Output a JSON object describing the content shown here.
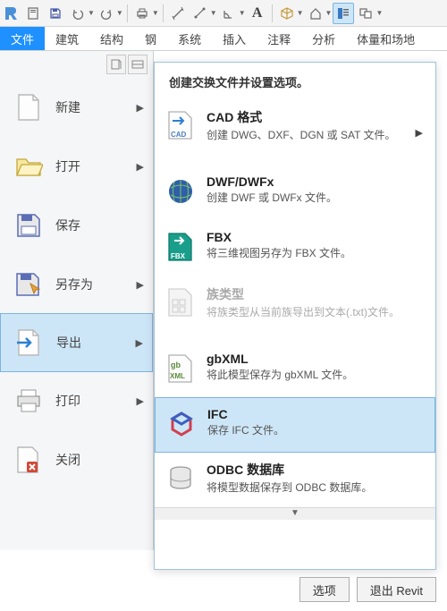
{
  "qat_icons": [
    "logo",
    "page",
    "save",
    "undo",
    "redo",
    "print",
    "measure",
    "dim-angle",
    "dim-radial",
    "text",
    "cube",
    "home",
    "section",
    "props",
    "link"
  ],
  "ribbon_tabs": [
    "文件",
    "建筑",
    "结构",
    "钢",
    "系统",
    "插入",
    "注释",
    "分析",
    "体量和场地"
  ],
  "file_menu": [
    {
      "label": "新建",
      "icon": "new",
      "arrow": true
    },
    {
      "label": "打开",
      "icon": "open",
      "arrow": true
    },
    {
      "label": "保存",
      "icon": "save",
      "arrow": false
    },
    {
      "label": "另存为",
      "icon": "saveas",
      "arrow": true
    },
    {
      "label": "导出",
      "icon": "export",
      "arrow": true,
      "selected": true
    },
    {
      "label": "打印",
      "icon": "print",
      "arrow": true
    },
    {
      "label": "关闭",
      "icon": "close",
      "arrow": false
    }
  ],
  "export_header": "创建交换文件并设置选项。",
  "export_items": [
    {
      "title": "CAD 格式",
      "desc": "创建 DWG、DXF、DGN 或 SAT 文件。",
      "icon": "cad",
      "arrow": true
    },
    {
      "title": "DWF/DWFx",
      "desc": "创建 DWF 或 DWFx 文件。",
      "icon": "dwf"
    },
    {
      "title": "FBX",
      "desc": "将三维视图另存为 FBX 文件。",
      "icon": "fbx"
    },
    {
      "title": "族类型",
      "desc": "将族类型从当前族导出到文本(.txt)文件。",
      "icon": "fam",
      "disabled": true
    },
    {
      "title": "gbXML",
      "desc": "将此模型保存为 gbXML 文件。",
      "icon": "gbxml"
    },
    {
      "title": "IFC",
      "desc": "保存 IFC 文件。",
      "icon": "ifc",
      "hover": true
    },
    {
      "title": "ODBC 数据库",
      "desc": "将模型数据保存到 ODBC 数据库。",
      "icon": "odbc"
    }
  ],
  "footer": {
    "options": "选项",
    "exit": "退出 Revit"
  }
}
